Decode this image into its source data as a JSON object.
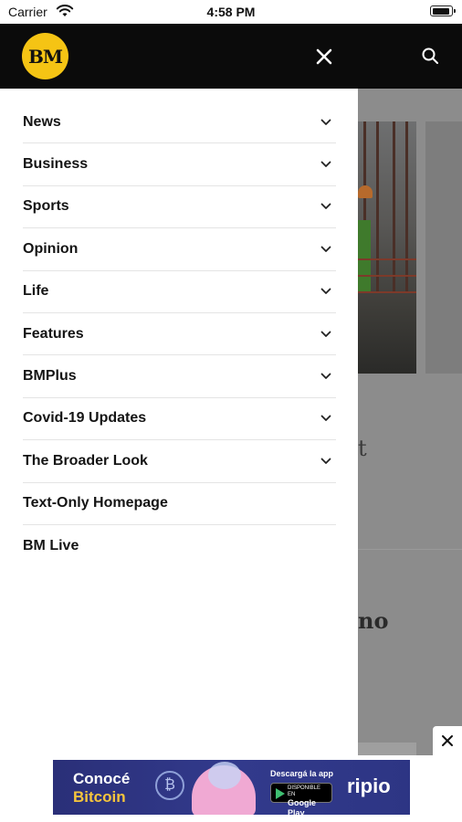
{
  "status_bar": {
    "carrier": "Carrier",
    "time": "4:58 PM",
    "battery_level": 0.95
  },
  "header": {
    "logo_text": "BM",
    "close_icon": "close-icon",
    "search_icon": "search-icon"
  },
  "menu": {
    "items": [
      {
        "label": "News",
        "expandable": true
      },
      {
        "label": "Business",
        "expandable": true
      },
      {
        "label": "Sports",
        "expandable": true
      },
      {
        "label": "Opinion",
        "expandable": true
      },
      {
        "label": "Life",
        "expandable": true
      },
      {
        "label": "Features",
        "expandable": true
      },
      {
        "label": "BMPlus",
        "expandable": true
      },
      {
        "label": "Covid-19 Updates",
        "expandable": true
      },
      {
        "label": "The Broader Look",
        "expandable": true
      },
      {
        "label": "Text-Only Homepage",
        "expandable": false
      },
      {
        "label": "BM Live",
        "expandable": false
      }
    ]
  },
  "background": {
    "text_fragment_1": "t",
    "text_fragment_2": "no"
  },
  "ad": {
    "headline_1": "Conocé",
    "headline_2": "Bitcoin",
    "download_label": "Descargá la app",
    "store_small": "DISPONIBLE EN",
    "store_name": "Google Play",
    "brand": "ripio"
  },
  "colors": {
    "header_bg": "#0b0b0b",
    "logo_bg": "#f5c414",
    "overlay": "#8c8c8c",
    "ad_bg": "#2d3584",
    "ad_accent": "#f6c53c"
  }
}
